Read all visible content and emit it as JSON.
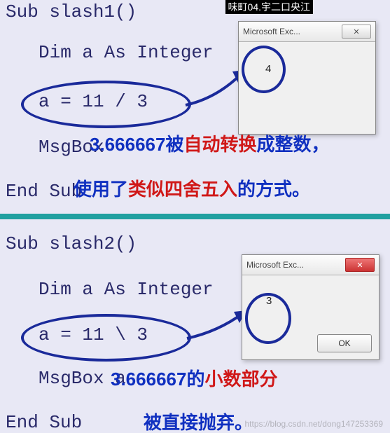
{
  "top_fragment": "味町04.宇二口央江",
  "panel1": {
    "code": {
      "sub": "Sub slash1()",
      "dim": "Dim a As Integer",
      "assign": "a = 11 / 3",
      "msg": "MsgBox",
      "end": "End Sub"
    },
    "dialog": {
      "title": "Microsoft Exc...",
      "close": "✕",
      "value": "4"
    },
    "anno1": {
      "p1_blue": "3.666667被",
      "p2_red": "自动转换",
      "p3_blue": "成整数，"
    },
    "anno2": {
      "p1_blue": "使用了",
      "p2_red": "类似四舍五入",
      "p3_blue": "的方式。"
    }
  },
  "panel2": {
    "code": {
      "sub": "Sub slash2()",
      "dim": "Dim a As Integer",
      "assign": "a = 11 \\ 3",
      "msg": "MsgBox a",
      "end": "End Sub"
    },
    "dialog": {
      "title": "Microsoft Exc...",
      "close": "✕",
      "value": "3",
      "ok": "OK"
    },
    "anno1": {
      "p1_blue": "3.666667的",
      "p2_red": "小数部分"
    },
    "anno2": {
      "p1_blue": "被直接抛弃。"
    }
  },
  "watermark": "https://blog.csdn.net/dong147253369"
}
